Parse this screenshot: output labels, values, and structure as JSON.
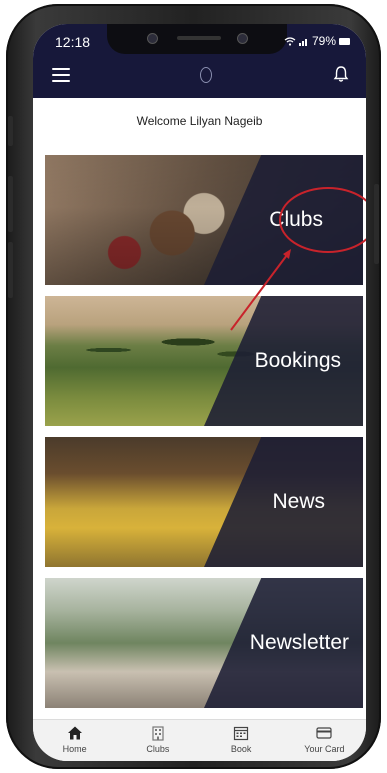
{
  "status_bar": {
    "time": "12:18",
    "battery": "79%"
  },
  "header": {
    "menu_icon": "hamburger-icon",
    "logo_icon": "club-logo-icon",
    "notification_icon": "bell-icon",
    "background_color": "#17183a"
  },
  "welcome": {
    "text": "Welcome Lilyan Nageib"
  },
  "cards": [
    {
      "label": "Clubs"
    },
    {
      "label": "Bookings"
    },
    {
      "label": "News"
    },
    {
      "label": "Newsletter"
    }
  ],
  "annotation": {
    "color": "#c8232b"
  },
  "bottom_nav": {
    "items": [
      {
        "label": "Home",
        "icon": "home-icon"
      },
      {
        "label": "Clubs",
        "icon": "building-icon"
      },
      {
        "label": "Book",
        "icon": "calendar-icon"
      },
      {
        "label": "Your Card",
        "icon": "card-icon"
      }
    ]
  }
}
